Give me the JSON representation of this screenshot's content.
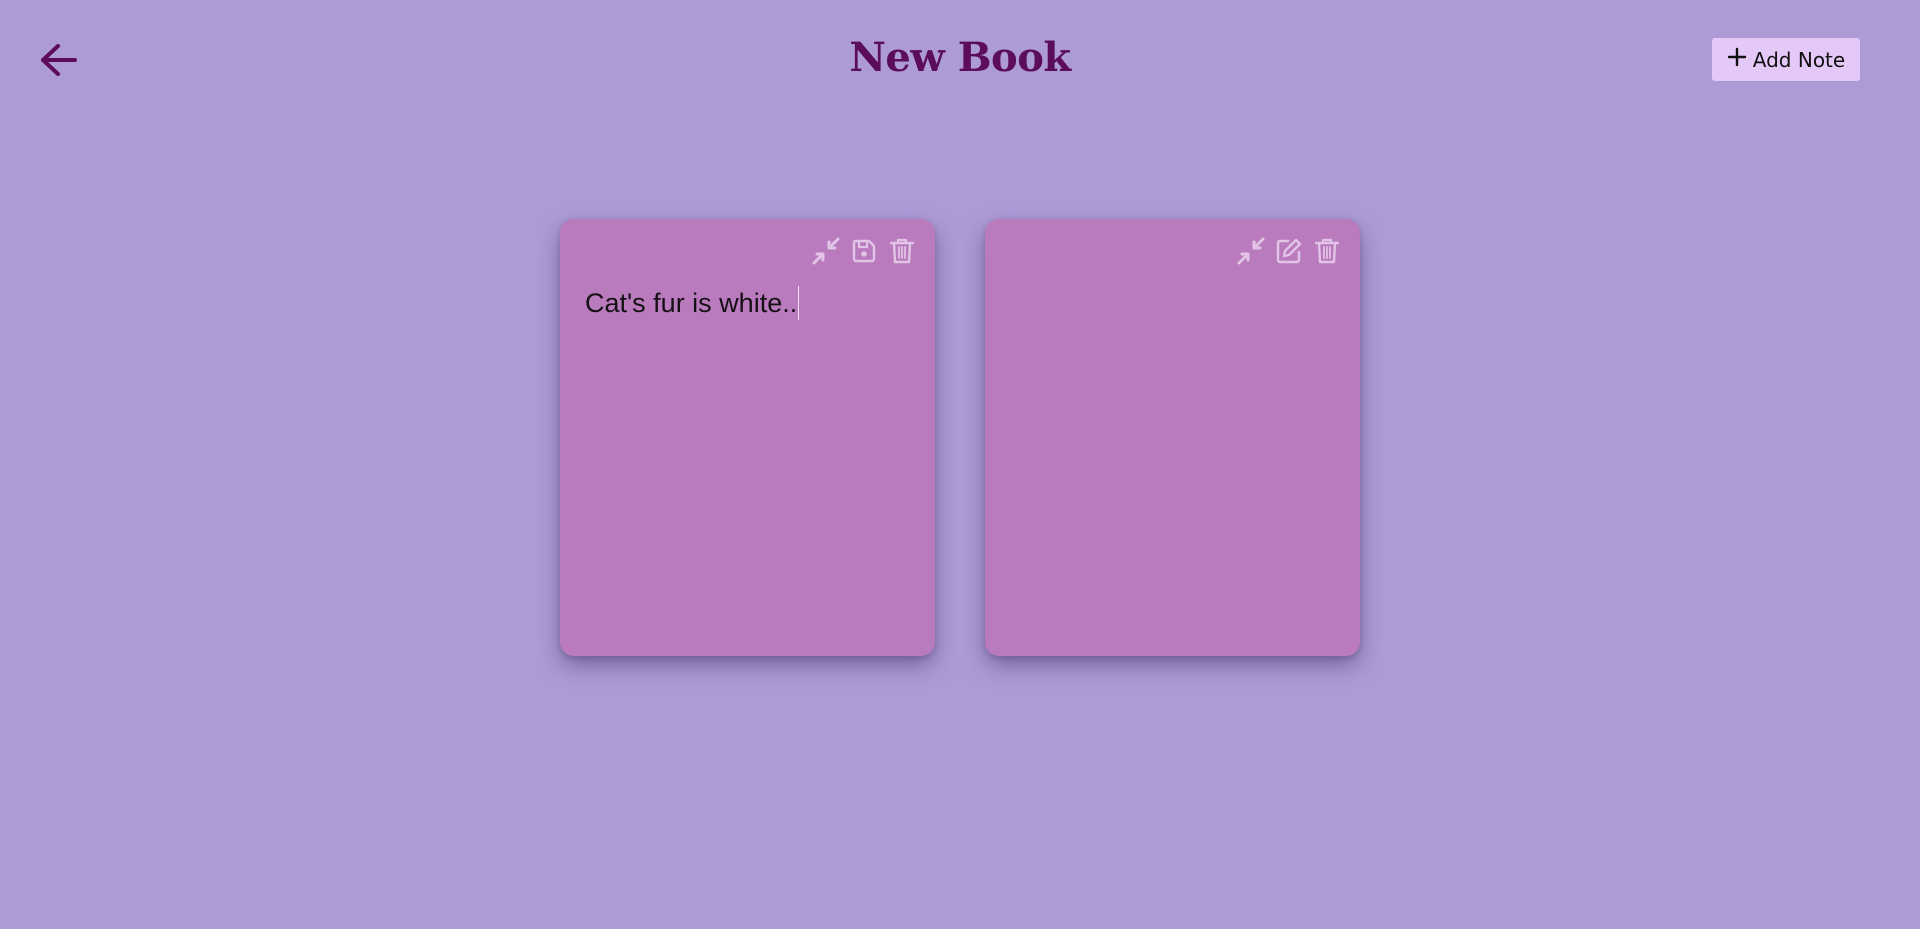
{
  "header": {
    "title": "New Book",
    "back_icon": "arrow-left-icon",
    "add_note_icon": "plus-icon",
    "add_note_label": "Add Note"
  },
  "notes": [
    {
      "text": "Cat's fur is white..",
      "mode": "editing",
      "actions": [
        "collapse-icon",
        "save-icon",
        "trash-icon"
      ]
    },
    {
      "text": "",
      "mode": "viewing",
      "actions": [
        "collapse-icon",
        "edit-icon",
        "trash-icon"
      ]
    }
  ],
  "colors": {
    "background": "#ad9bd6",
    "title": "#5b0c5a",
    "note": "#b97bbd",
    "button": "#e4c8f8",
    "icon": "#e2c4e6"
  }
}
